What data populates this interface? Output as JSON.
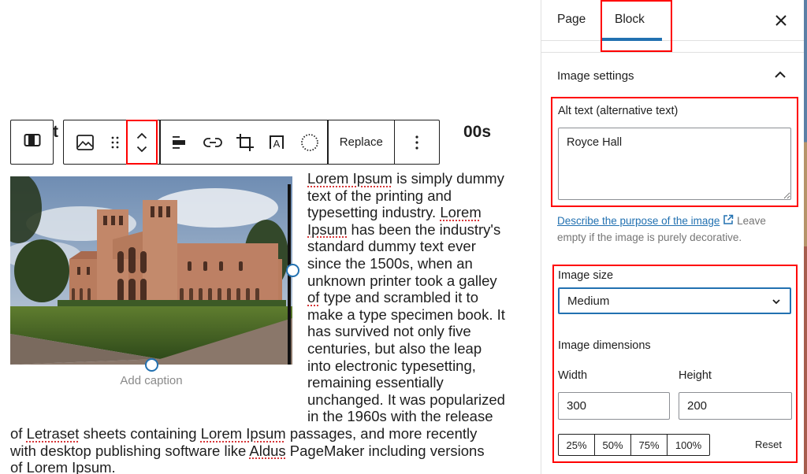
{
  "editor": {
    "heading_fragment_left": "t",
    "heading_fragment_right": "00s",
    "toolbar": {
      "parent_block_icon": "align-block-icon",
      "block_type_icon": "image-icon",
      "drag_icon": "drag-handle-icon",
      "move_icon": "move-up-down-icon",
      "align_icon": "align-left-icon",
      "link_icon": "link-icon",
      "crop_icon": "crop-icon",
      "text_overlay_icon": "text-overlay-icon",
      "duotone_icon": "duotone-icon",
      "replace_label": "Replace",
      "options_icon": "more-options-icon"
    },
    "image": {
      "alt": "Royce Hall"
    },
    "caption_placeholder": "Add caption",
    "paragraph_lines": [
      [
        {
          "t": "Lorem Ipsum",
          "sp": true
        },
        {
          "t": " is simply dummy"
        }
      ],
      [
        {
          "t": "text of the printing and"
        }
      ],
      [
        {
          "t": "typesetting industry. "
        },
        {
          "t": "Lorem",
          "sp": true
        }
      ],
      [
        {
          "t": "Ipsum",
          "sp": true
        },
        {
          "t": " has been the industry's"
        }
      ],
      [
        {
          "t": "standard dummy text ever"
        }
      ],
      [
        {
          "t": "since the 1500s, when an"
        }
      ],
      [
        {
          "t": "unknown printer took a galley"
        }
      ],
      [
        {
          "t": "of",
          "sp": true
        },
        {
          "t": " type and scrambled it to"
        }
      ],
      [
        {
          "t": "make a type specimen book. It"
        }
      ],
      [
        {
          "t": "has survived not only five"
        }
      ],
      [
        {
          "t": "centuries, but also the leap"
        }
      ],
      [
        {
          "t": "into electronic typesetting,"
        }
      ],
      [
        {
          "t": "remaining essentially"
        }
      ],
      [
        {
          "t": "unchanged. It was popularized"
        }
      ],
      [
        {
          "t": "in the 1960s with the release"
        }
      ],
      [
        {
          "t": "of "
        },
        {
          "t": "Letraset",
          "sp": true
        },
        {
          "t": " sheets containing "
        },
        {
          "t": "Lorem Ipsum",
          "sp": true
        },
        {
          "t": " passages, and more recently"
        }
      ],
      [
        {
          "t": "with desktop publishing software like "
        },
        {
          "t": "Aldus",
          "sp": true
        },
        {
          "t": " PageMaker including versions"
        }
      ],
      [
        {
          "t": "of "
        },
        {
          "t": "Lorem Ipsum",
          "sp": true
        },
        {
          "t": "."
        }
      ]
    ]
  },
  "sidebar": {
    "tabs": [
      {
        "label": "Page",
        "active": false
      },
      {
        "label": "Block",
        "active": true
      }
    ],
    "close_icon": "close-icon",
    "panel": {
      "title": "Image settings",
      "expanded": true,
      "alt_label": "Alt text (alternative text)",
      "alt_value": "Royce Hall",
      "help_link": "Describe the purpose of the image",
      "help_text": " Leave empty if the image is purely decorative.",
      "size_label": "Image size",
      "size_value": "Medium",
      "dimensions_label": "Image dimensions",
      "width_label": "Width",
      "width_value": "300",
      "height_label": "Height",
      "height_value": "200",
      "scale_buttons": [
        "25%",
        "50%",
        "75%",
        "100%"
      ],
      "reset_label": "Reset"
    }
  },
  "colors": {
    "accent": "#2271b1",
    "highlight": "#ff0000",
    "text": "#1e1e1e",
    "muted": "#757575",
    "spellcheck": "#d63638"
  }
}
